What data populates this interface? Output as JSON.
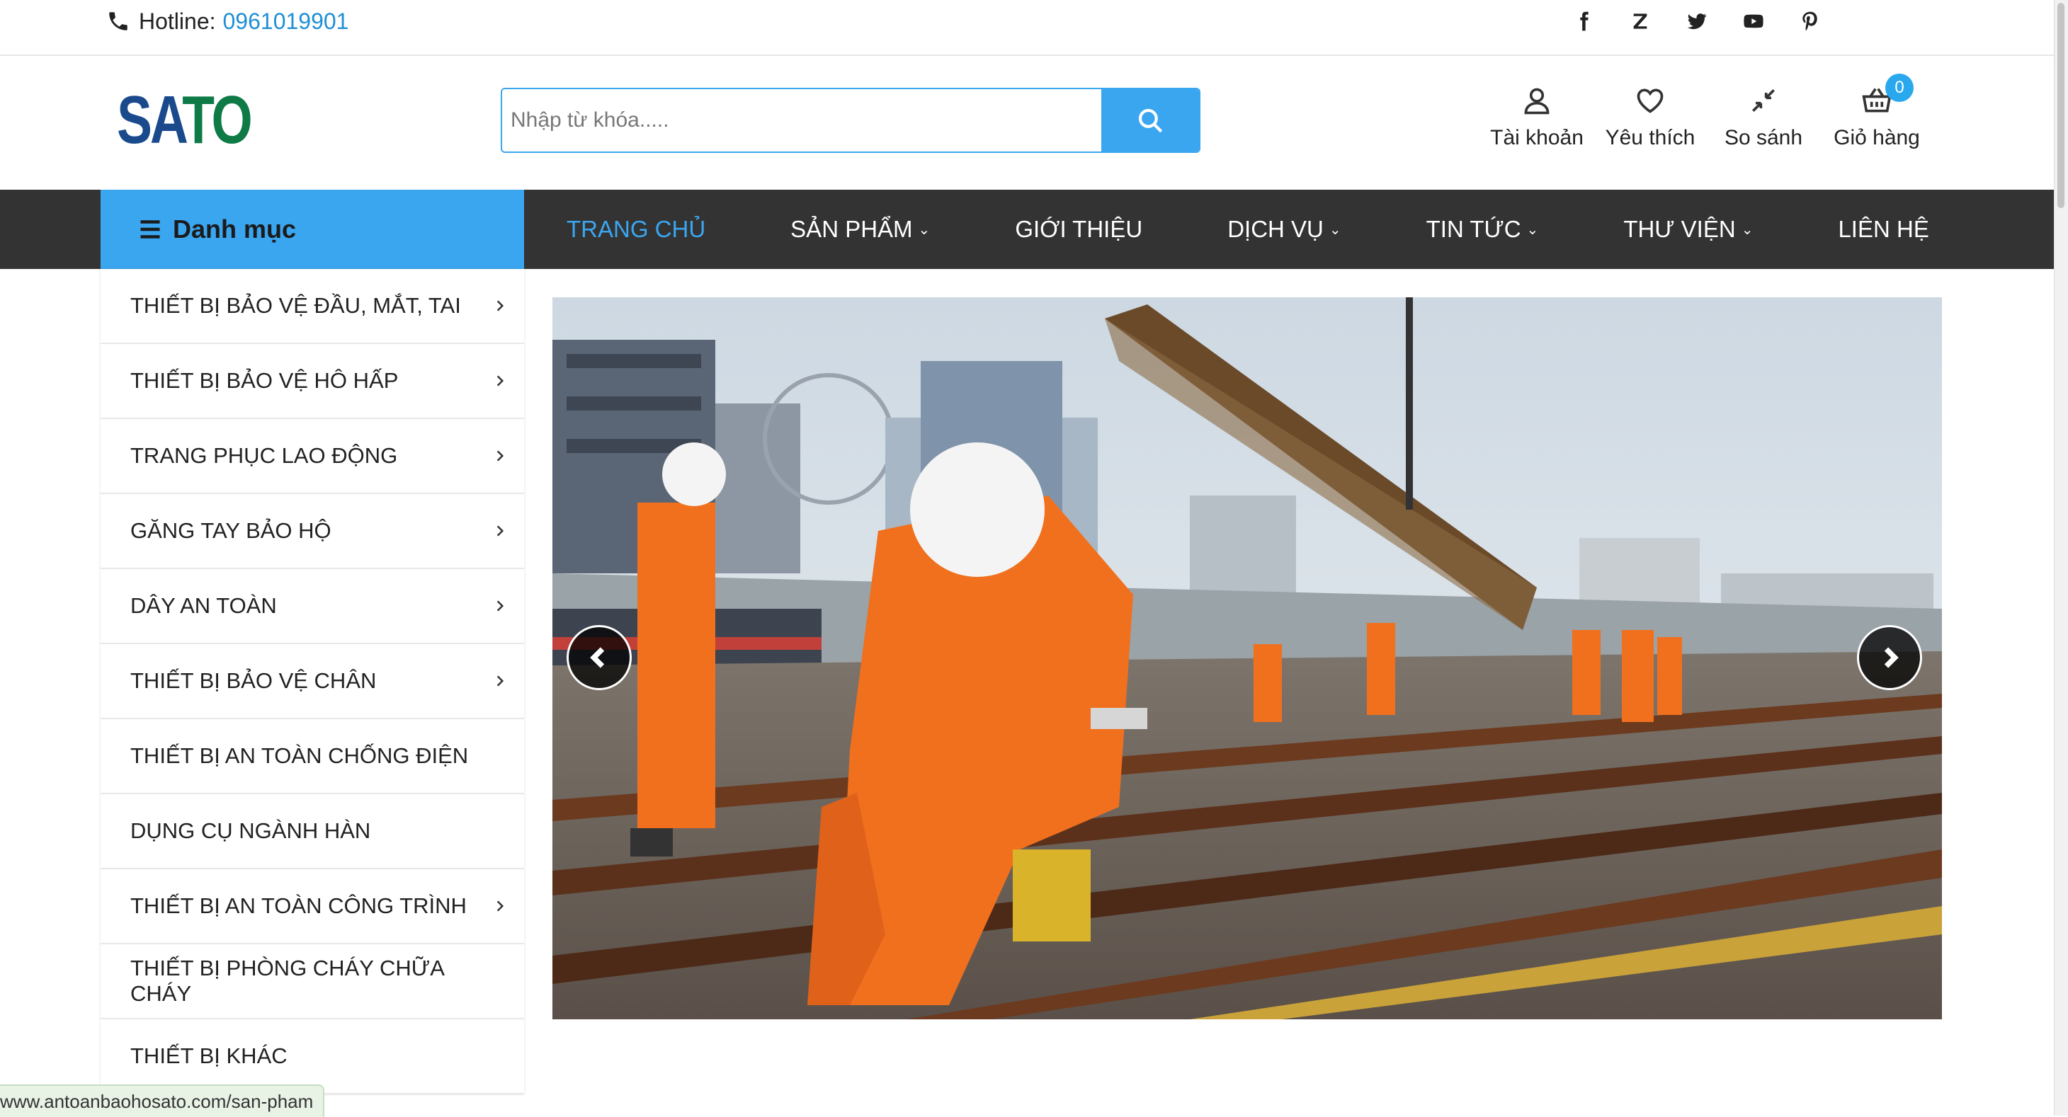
{
  "topbar": {
    "hotline_label": "Hotline:",
    "hotline_number": "0961019901",
    "socials": [
      "facebook-icon",
      "zalo-icon",
      "twitter-icon",
      "youtube-icon",
      "pinterest-icon"
    ]
  },
  "header": {
    "logo_part1": "SA",
    "logo_part2": "TO",
    "search_placeholder": "Nhập từ khóa.....",
    "tools": {
      "account": "Tài khoản",
      "wishlist": "Yêu thích",
      "compare": "So sánh",
      "cart": "Giỏ hàng",
      "cart_count": "0"
    }
  },
  "nav": {
    "category_label": "Danh mục",
    "items": [
      {
        "label": "TRANG CHỦ"
      },
      {
        "label": "SẢN PHẨM"
      },
      {
        "label": "GIỚI THIỆU"
      },
      {
        "label": "DỊCH VỤ"
      },
      {
        "label": "TIN TỨC"
      },
      {
        "label": "THƯ VIỆN"
      },
      {
        "label": "LIÊN HỆ"
      }
    ]
  },
  "sidebar": {
    "items": [
      {
        "label": "THIẾT BỊ BẢO VỆ ĐẦU, MẮT, TAI"
      },
      {
        "label": "THIẾT BỊ BẢO VỆ HÔ HẤP"
      },
      {
        "label": "TRANG PHỤC LAO ĐỘNG"
      },
      {
        "label": "GĂNG TAY BẢO HỘ"
      },
      {
        "label": "DÂY AN TOÀN"
      },
      {
        "label": "THIẾT BỊ BẢO VỆ CHÂN"
      },
      {
        "label": "THIẾT BỊ AN TOÀN CHỐNG ĐIỆN"
      },
      {
        "label": "DỤNG CỤ NGÀNH HÀN"
      },
      {
        "label": "THIẾT BỊ AN TOÀN CÔNG TRÌNH"
      },
      {
        "label": "THIẾT BỊ PHÒNG CHÁY CHỮA CHÁY"
      },
      {
        "label": "THIẾT BỊ KHÁC"
      }
    ]
  },
  "status_bar": {
    "url": "www.antoanbaohosato.com/san-pham"
  },
  "colors": {
    "accent": "#3aa6f0",
    "nav_bg": "#333333",
    "logo_blue": "#1a4a8c",
    "logo_green": "#0e7a46",
    "worker_orange": "#f0701e"
  }
}
